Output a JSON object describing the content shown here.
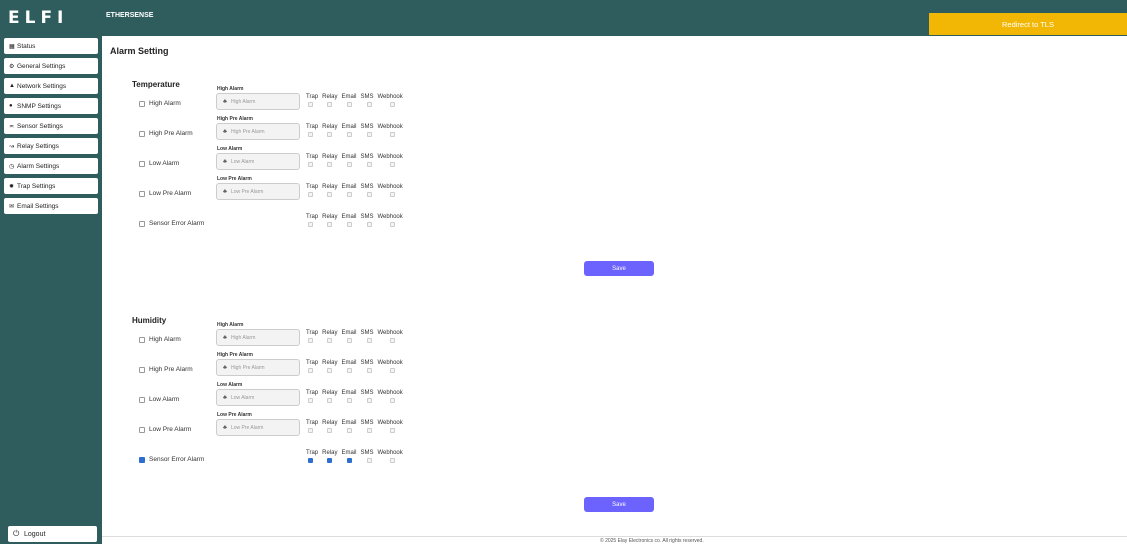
{
  "brand": {
    "logo": "ELFI"
  },
  "header": {
    "app_name": "ETHERSENSE",
    "tls_button": "Redirect to TLS"
  },
  "sidebar": {
    "items": [
      {
        "label": "Status",
        "icon": "grid-icon"
      },
      {
        "label": "General Settings",
        "icon": "gear-icon"
      },
      {
        "label": "Network Settings",
        "icon": "network-icon"
      },
      {
        "label": "SNMP Settings",
        "icon": "globe-icon"
      },
      {
        "label": "Sensor Settings",
        "icon": "sensor-icon"
      },
      {
        "label": "Relay Settings",
        "icon": "relay-icon"
      },
      {
        "label": "Alarm Settings",
        "icon": "alarm-icon"
      },
      {
        "label": "Trap Settings",
        "icon": "bug-icon"
      },
      {
        "label": "Email Settings",
        "icon": "mail-icon"
      }
    ],
    "logout": "Logout"
  },
  "page": {
    "title": "Alarm Setting"
  },
  "option_labels": [
    "Trap",
    "Relay",
    "Email",
    "SMS",
    "Webhook"
  ],
  "sections": [
    {
      "title": "Temperature",
      "save_label": "Save",
      "rows": [
        {
          "label": "High Alarm",
          "enabled": false,
          "field_label": "High Alarm",
          "placeholder": "High Alarm",
          "options": [
            false,
            false,
            false,
            false,
            false
          ]
        },
        {
          "label": "High Pre Alarm",
          "enabled": false,
          "field_label": "High Pre Alarm",
          "placeholder": "High Pre Alarm",
          "options": [
            false,
            false,
            false,
            false,
            false
          ]
        },
        {
          "label": "Low Alarm",
          "enabled": false,
          "field_label": "Low Alarm",
          "placeholder": "Low Alarm",
          "options": [
            false,
            false,
            false,
            false,
            false
          ]
        },
        {
          "label": "Low Pre Alarm",
          "enabled": false,
          "field_label": "Low Pre Alarm",
          "placeholder": "Low Pre Alarm",
          "options": [
            false,
            false,
            false,
            false,
            false
          ]
        },
        {
          "label": "Sensor Error Alarm",
          "enabled": false,
          "options": [
            false,
            false,
            false,
            false,
            false
          ]
        }
      ]
    },
    {
      "title": "Humidity",
      "save_label": "Save",
      "rows": [
        {
          "label": "High Alarm",
          "enabled": false,
          "field_label": "High Alarm",
          "placeholder": "High Alarm",
          "options": [
            false,
            false,
            false,
            false,
            false
          ]
        },
        {
          "label": "High Pre Alarm",
          "enabled": false,
          "field_label": "High Pre Alarm",
          "placeholder": "High Pre Alarm",
          "options": [
            false,
            false,
            false,
            false,
            false
          ]
        },
        {
          "label": "Low Alarm",
          "enabled": false,
          "field_label": "Low Alarm",
          "placeholder": "Low Alarm",
          "options": [
            false,
            false,
            false,
            false,
            false
          ]
        },
        {
          "label": "Low Pre Alarm",
          "enabled": false,
          "field_label": "Low Pre Alarm",
          "placeholder": "Low Pre Alarm",
          "options": [
            false,
            false,
            false,
            false,
            false
          ]
        },
        {
          "label": "Sensor Error Alarm",
          "enabled": true,
          "options": [
            true,
            true,
            true,
            false,
            false
          ]
        }
      ]
    }
  ],
  "footer": {
    "text": "© 2025 Elay Electronics co. All rights reserved."
  }
}
